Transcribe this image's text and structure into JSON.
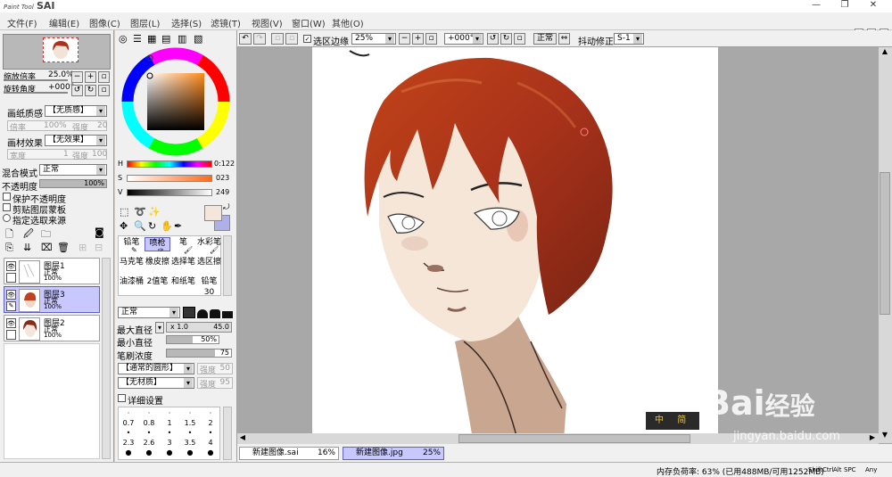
{
  "app": {
    "logo_small": "Paint Tool",
    "logo_big": "SAI"
  },
  "window_controls": {
    "minimize": "—",
    "restore": "❐",
    "close": "✕"
  },
  "menu": [
    "文件(F)",
    "编辑(E)",
    "图像(C)",
    "图层(L)",
    "选择(S)",
    "滤镜(T)",
    "视图(V)",
    "窗口(W)",
    "其他(O)"
  ],
  "navigator": {
    "zoom_label": "缩放倍率",
    "zoom_value": "25.0%",
    "angle_label": "旋转角度",
    "angle_value": "+000°"
  },
  "paper_texture": {
    "label": "画纸质感",
    "value": "【无质感】",
    "scale_label": "倍率",
    "scale_value": "100%",
    "strength_label": "强度",
    "strength_value": "20"
  },
  "paper_effect": {
    "label": "画材效果",
    "value": "【无效果】",
    "width_label": "宽度",
    "width_value": "1",
    "strength_label": "强度",
    "strength_value": "100"
  },
  "blend": {
    "label": "混合模式",
    "value": "正常",
    "opacity_label": "不透明度",
    "opacity_value": "100%",
    "opacity_level": 1.0
  },
  "options": {
    "protect": "保护不透明度",
    "clip": "剪贴图层蒙板",
    "source": "指定选取来源"
  },
  "layers": [
    {
      "name": "图层1",
      "mode": "正常",
      "opacity": "100%",
      "active": false
    },
    {
      "name": "图层3",
      "mode": "正常",
      "opacity": "100%",
      "active": true
    },
    {
      "name": "图层2",
      "mode": "正常",
      "opacity": "100%",
      "active": false
    }
  ],
  "color_sliders": {
    "h_label": "H",
    "h_value": "0:122",
    "s_label": "S",
    "s_value": "023",
    "v_label": "V",
    "v_value": "249"
  },
  "tools": [
    "铅笔",
    "喷枪",
    "笔",
    "水彩笔",
    "马克笔",
    "橡皮擦",
    "选择笔",
    "选区擦",
    "油漆桶",
    "2值笔",
    "和纸笔",
    "铅笔30"
  ],
  "brush": {
    "mode": "正常",
    "max_diam_label": "最大直径",
    "max_diam_mult": "x 1.0",
    "max_diam_value": "45.0",
    "min_diam_label": "最小直径",
    "min_diam_value": "50%",
    "min_diam_level": 0.5,
    "density_label": "笔刷浓度",
    "density_value": "75",
    "density_level": 0.75,
    "shape": "【通常的圆形】",
    "shape_strength_label": "强度",
    "shape_strength_value": "50",
    "texture": "【无材质】",
    "texture_strength_label": "强度",
    "texture_strength_value": "95",
    "details_label": "详细设置"
  },
  "brush_sizes": [
    "0.7",
    "0.8",
    "1",
    "1.5",
    "2",
    "2.3",
    "2.6",
    "3",
    "3.5",
    "4"
  ],
  "canvas_toolbar": {
    "selection_label": "选区边缘",
    "zoom": "25%",
    "angle": "+000°",
    "mode": "正常",
    "stabilizer_label": "抖动修正",
    "stabilizer_value": "S-1"
  },
  "tabs": [
    {
      "name": "新建图像.sai",
      "zoom": "16%",
      "active": false
    },
    {
      "name": "新建图像.jpg",
      "zoom": "25%",
      "active": true
    }
  ],
  "watermark": {
    "text1": "Bai",
    "text2": "经验",
    "url": "jingyan.baidu.com",
    "ime_left": "中",
    "ime_right": "简"
  },
  "status": {
    "memory": "内存负荷率: 63% (已用488MB/可用1252MB)",
    "keys": [
      "Shift",
      "Ctrl",
      "Alt",
      "SPC",
      "Any"
    ]
  },
  "colors": {
    "accent": "#c8c8ff",
    "hair": "#a8321a",
    "skin": "#f5e6d8",
    "primary_swatch": "#f3e6dc",
    "secondary_swatch": "#b0b0e8"
  }
}
